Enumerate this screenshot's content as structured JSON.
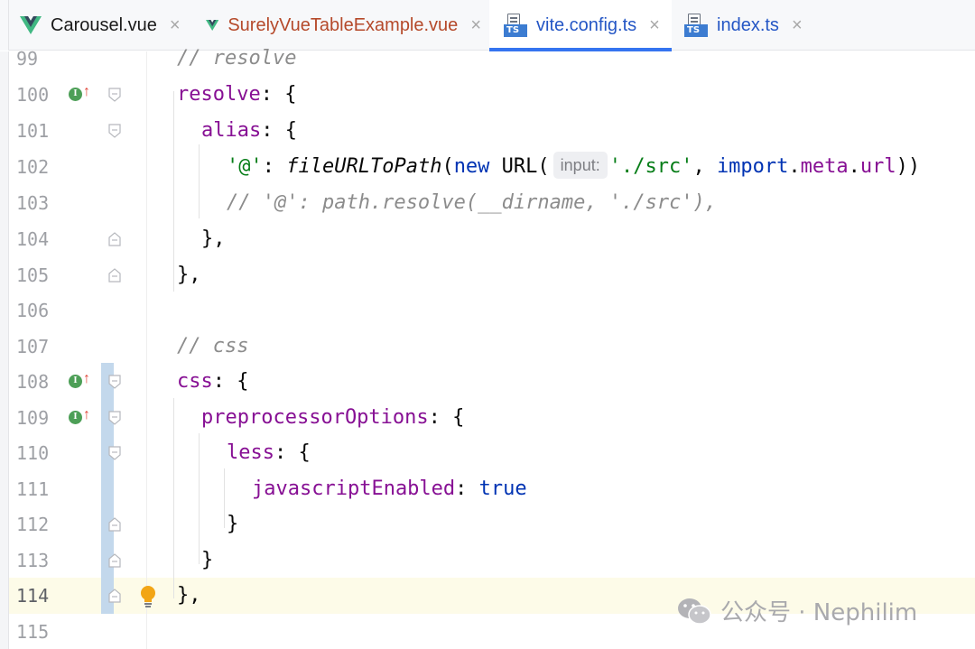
{
  "colors": {
    "accent": "#3574f0",
    "vue_green": "#41b883",
    "vue_dark": "#35495e",
    "vcs_changed": "#c3d8ec",
    "current_line": "#fdfbe8"
  },
  "tabs": [
    {
      "label": "Carousel.vue",
      "icon": "vue-icon",
      "color": "#1a1a1a",
      "active": false
    },
    {
      "label": "SurelyVueTableExample.vue",
      "icon": "vue-icon",
      "color": "#b5492a",
      "active": false
    },
    {
      "label": "vite.config.ts",
      "icon": "typescript-file-icon",
      "color": "#2456c5",
      "active": true
    },
    {
      "label": "index.ts",
      "icon": "typescript-file-icon",
      "color": "#2456c5",
      "active": false
    }
  ],
  "close_glyph": "×",
  "ts_badge": "TS",
  "implement_marker": "I",
  "lines": [
    {
      "num": "99"
    },
    {
      "num": "100"
    },
    {
      "num": "101"
    },
    {
      "num": "102"
    },
    {
      "num": "103"
    },
    {
      "num": "104"
    },
    {
      "num": "105"
    },
    {
      "num": "106"
    },
    {
      "num": "107"
    },
    {
      "num": "108"
    },
    {
      "num": "109"
    },
    {
      "num": "110"
    },
    {
      "num": "111"
    },
    {
      "num": "112"
    },
    {
      "num": "113"
    },
    {
      "num": "114"
    },
    {
      "num": "115"
    }
  ],
  "code": {
    "l99": "// resolve",
    "l100_key": "resolve",
    "l100_rest": ": {",
    "l101_key": "alias",
    "l101_rest": ": {",
    "l102_str1": "'@'",
    "l102_colon": ": ",
    "l102_fn": "fileURLToPath",
    "l102_paren": "(",
    "l102_new": "new",
    "l102_url": " URL(",
    "l102_hint": "input:",
    "l102_str2": "'./src'",
    "l102_comma": ", ",
    "l102_import": "import",
    "l102_dot1": ".",
    "l102_meta": "meta",
    "l102_dot2": ".",
    "l102_urlprop": "url",
    "l102_close": "))",
    "l103": "// '@': path.resolve(__dirname, './src'),",
    "l104": "},",
    "l105": "},",
    "l107": "// css",
    "l108_key": "css",
    "l108_rest": ": {",
    "l109_key": "preprocessorOptions",
    "l109_rest": ": {",
    "l110_key": "less",
    "l110_rest": ": {",
    "l111_key": "javascriptEnabled",
    "l111_colon": ": ",
    "l111_val": "true",
    "l112": "}",
    "l113": "}",
    "l114": "},"
  },
  "watermark": "公众号 · Nephilim"
}
